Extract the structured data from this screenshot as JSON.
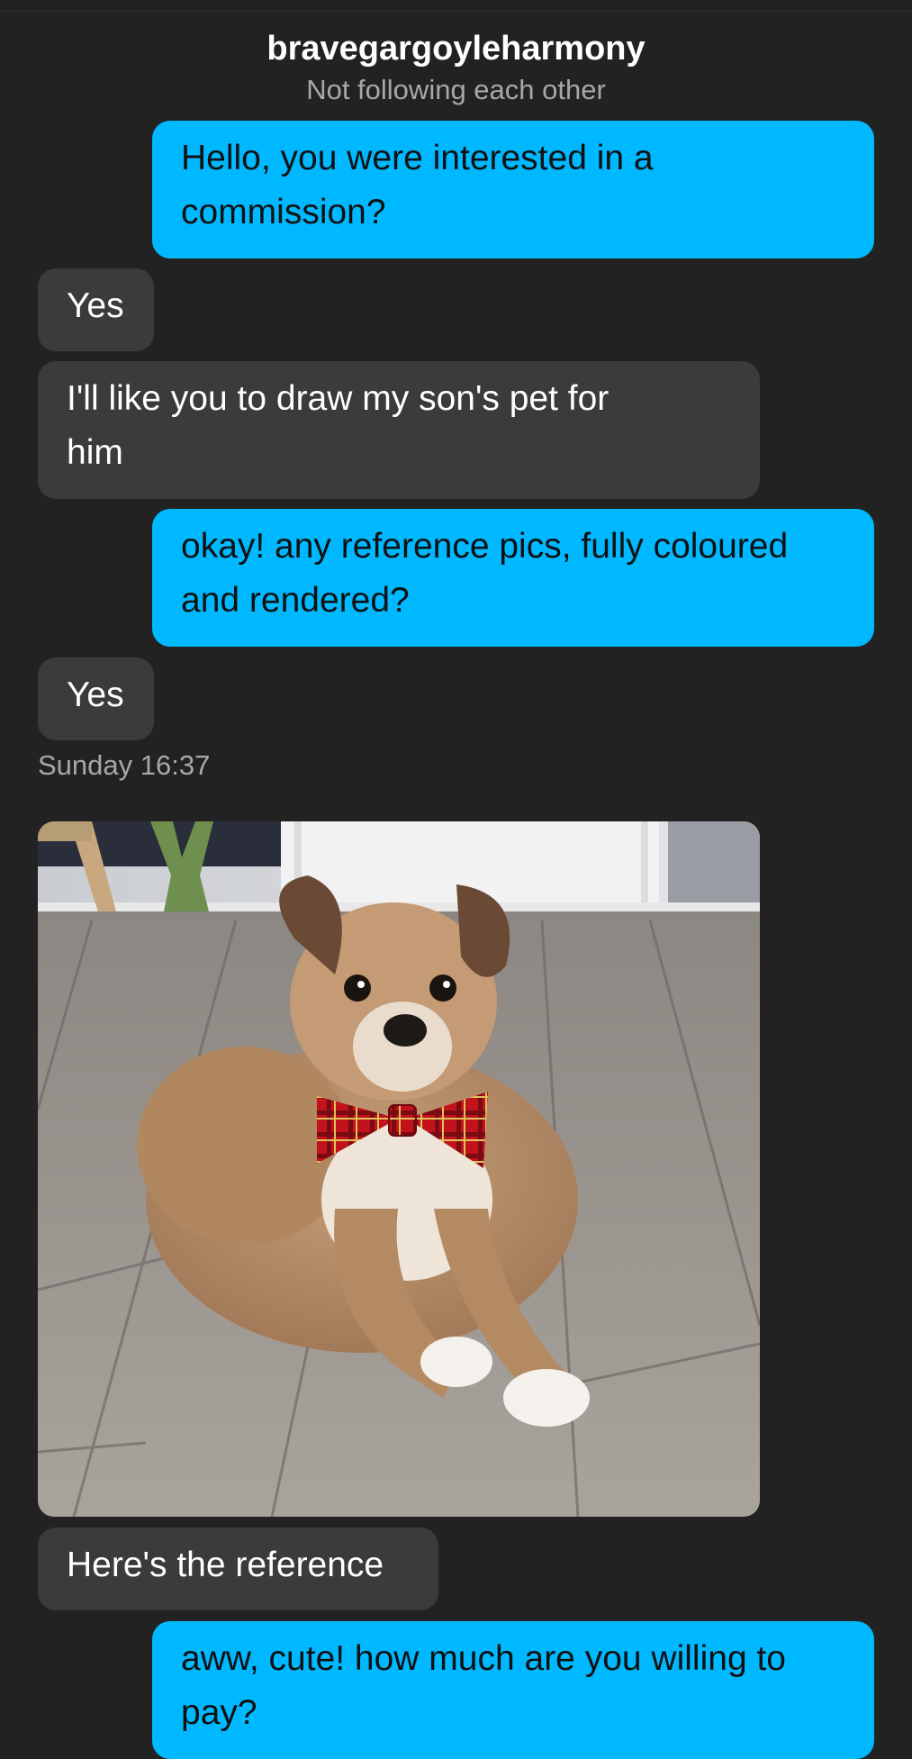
{
  "conversation": {
    "username": "bravegargoyleharmony",
    "relationship": "Not following each other"
  },
  "messages": [
    {
      "sender": "me",
      "text": "Hello, you were interested in a commission?"
    },
    {
      "sender": "them",
      "text": "Yes"
    },
    {
      "sender": "them",
      "text": "I'll like you to draw my son's pet for him"
    },
    {
      "sender": "me",
      "text": "okay! any reference pics, fully coloured and rendered?"
    },
    {
      "sender": "them",
      "text": "Yes"
    },
    {
      "sender": "them",
      "text": "Here's the reference"
    },
    {
      "sender": "me",
      "text": "aww, cute! how much are you willing to pay?"
    }
  ],
  "timestamp": "Sunday 16:37",
  "shared_image": {
    "subject": "dog-wearing-red-tartan-bowtie"
  },
  "colors": {
    "background": "#222222",
    "outgoing_bubble": "#00b8ff",
    "incoming_bubble": "#3b3b3b",
    "muted_text": "#a8a8a8"
  }
}
